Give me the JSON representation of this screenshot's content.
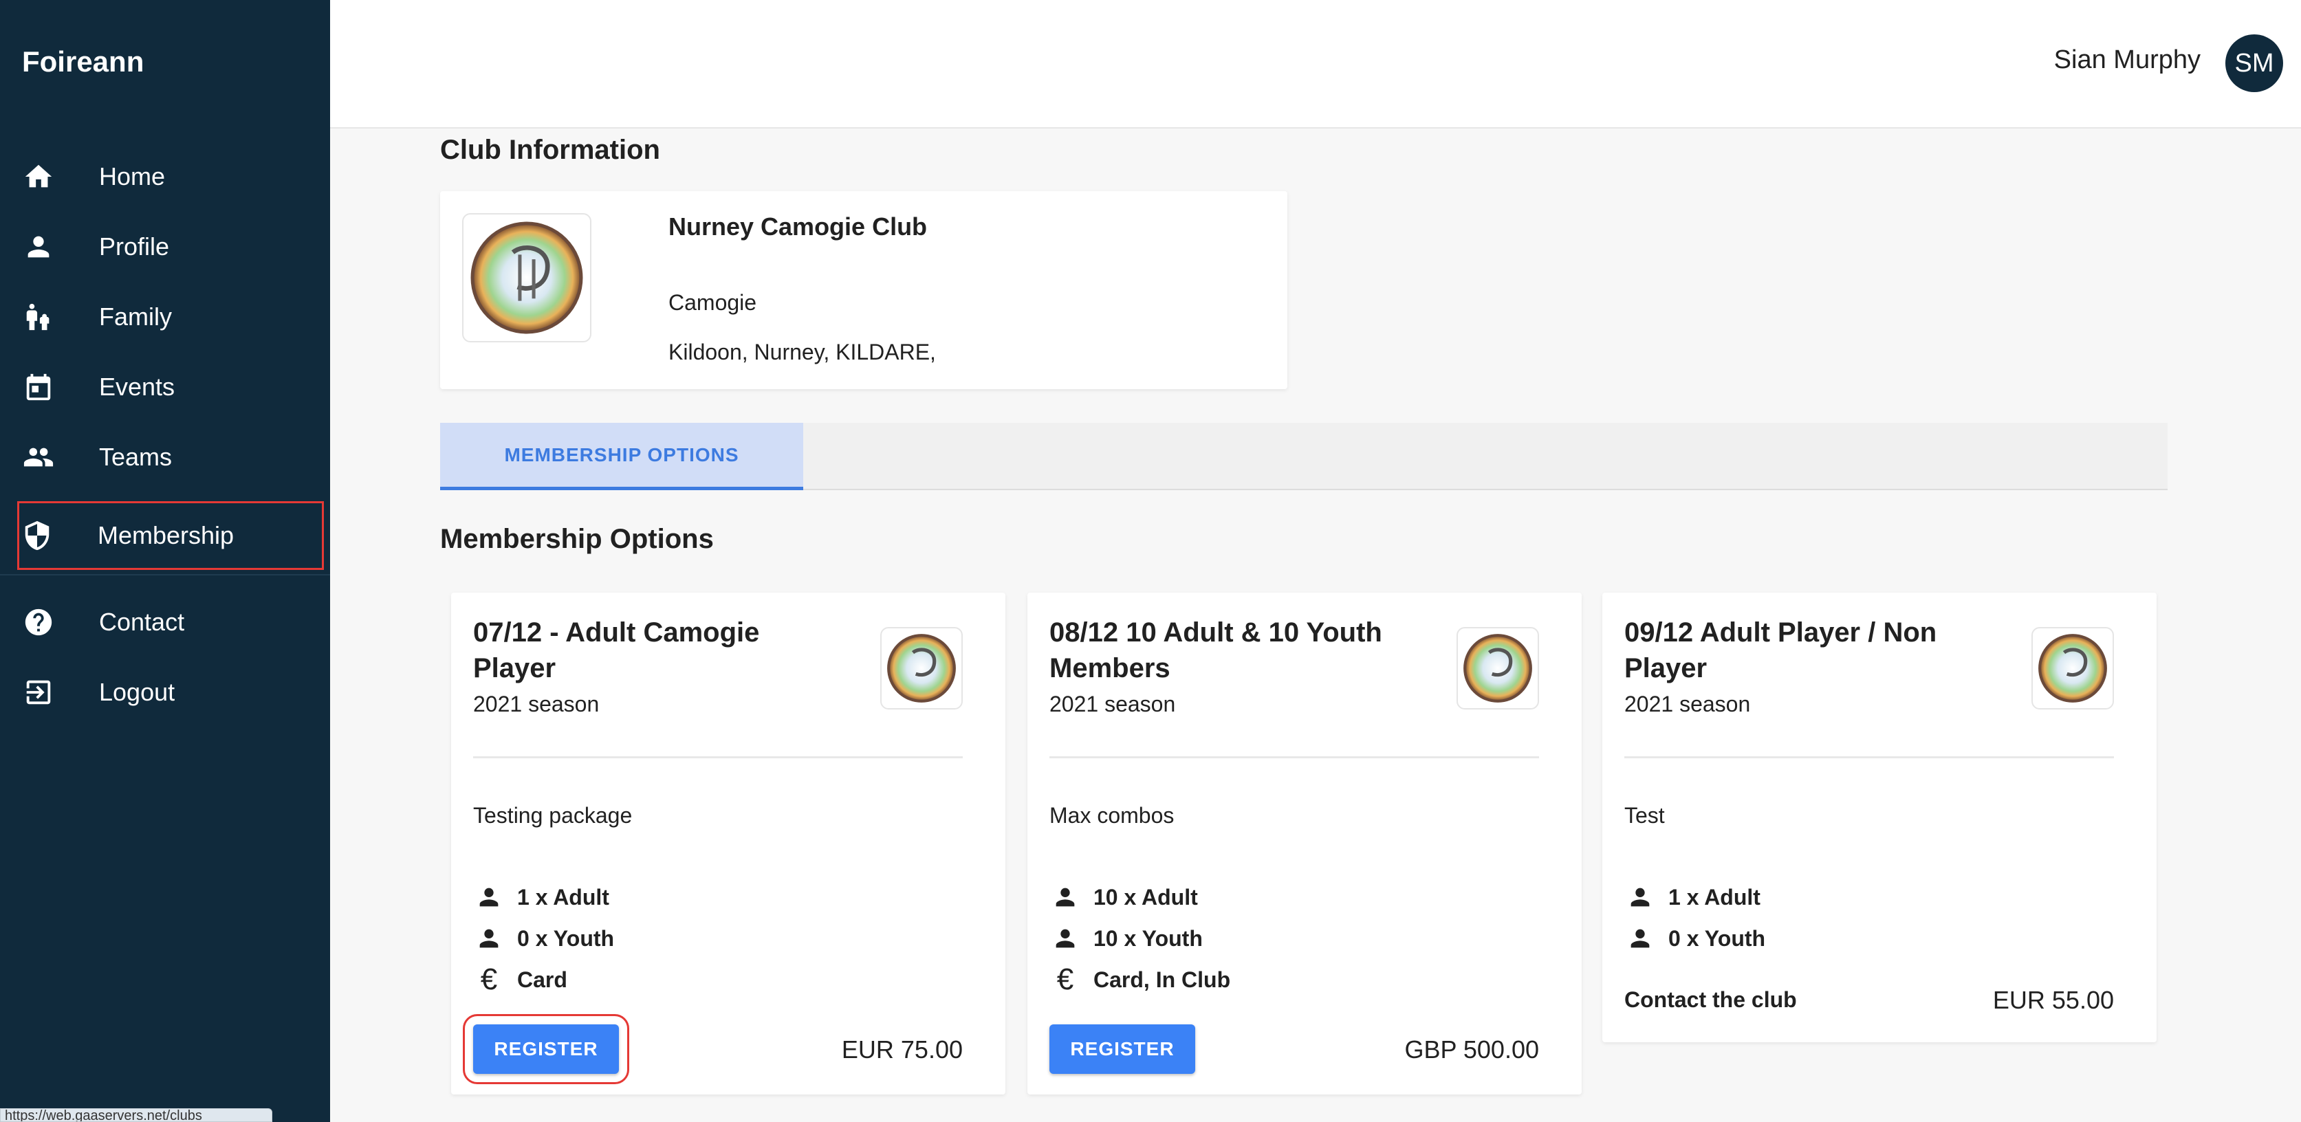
{
  "app": {
    "brand": "Foireann"
  },
  "sidebar": {
    "items": [
      {
        "label": "Home",
        "icon": "home-icon"
      },
      {
        "label": "Profile",
        "icon": "person-icon"
      },
      {
        "label": "Family",
        "icon": "family-icon"
      },
      {
        "label": "Events",
        "icon": "calendar-icon"
      },
      {
        "label": "Teams",
        "icon": "group-icon"
      },
      {
        "label": "Membership",
        "icon": "shield-icon"
      },
      {
        "label": "Contact",
        "icon": "help-icon"
      },
      {
        "label": "Logout",
        "icon": "logout-icon"
      }
    ]
  },
  "header": {
    "user_name": "Sian Murphy",
    "avatar_initials": "SM"
  },
  "club": {
    "section_title": "Club Information",
    "name": "Nurney Camogie Club",
    "sport": "Camogie",
    "address": "Kildoon, Nurney, KILDARE,"
  },
  "tabs": [
    {
      "label": "MEMBERSHIP OPTIONS"
    }
  ],
  "membership": {
    "section_title": "Membership Options",
    "cards": [
      {
        "title": "07/12 - Adult Camogie Player",
        "season": "2021 season",
        "description": "Testing package",
        "adult": "1 x Adult",
        "youth": "0 x Youth",
        "payment": "Card",
        "action_label": "REGISTER",
        "price": "EUR 75.00"
      },
      {
        "title": "08/12 10 Adult & 10 Youth Members",
        "season": "2021 season",
        "description": "Max combos",
        "adult": "10 x Adult",
        "youth": "10 x Youth",
        "payment": "Card, In Club",
        "action_label": "REGISTER",
        "price": "GBP 500.00"
      },
      {
        "title": "09/12 Adult Player / Non Player",
        "season": "2021 season",
        "description": "Test",
        "adult": "1 x Adult",
        "youth": "0 x Youth",
        "action_label": "Contact the club",
        "price": "EUR 55.00"
      }
    ]
  },
  "status_bar": {
    "url": "https://web.gaaservers.net/clubs"
  },
  "colors": {
    "sidebar_bg": "#102a3c",
    "accent": "#3b82f6",
    "highlight": "#e53935"
  }
}
